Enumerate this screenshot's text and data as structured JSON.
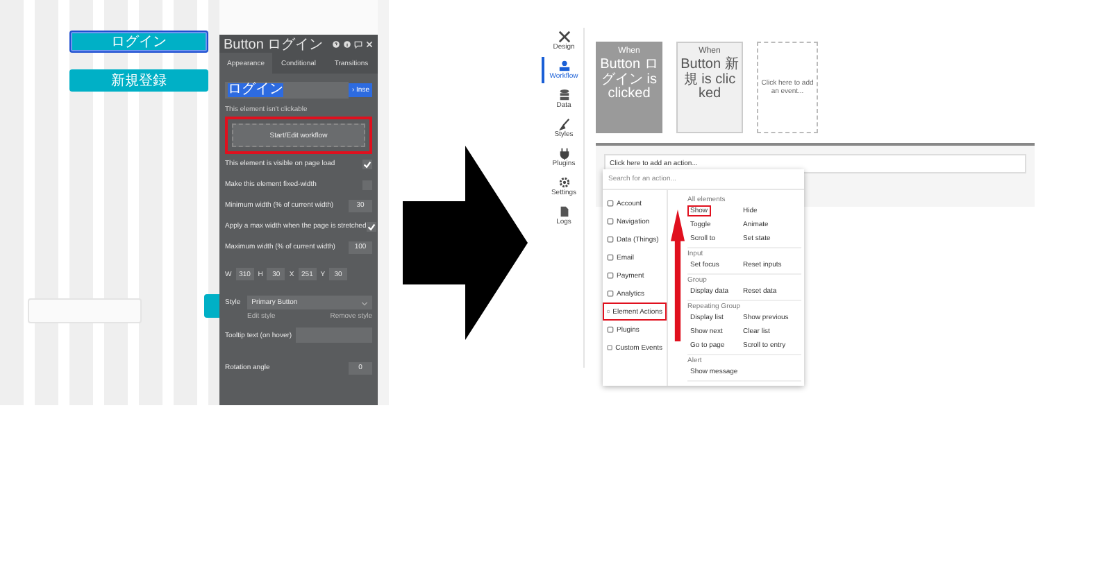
{
  "editor_left": {
    "canvas_buttons": [
      {
        "label": "ログイン",
        "selected": true
      },
      {
        "label": "新規登録",
        "selected": false
      }
    ],
    "panel": {
      "title": "Button ログイン",
      "tabs": [
        {
          "label": "Appearance",
          "selected": true
        },
        {
          "label": "Conditional",
          "selected": false
        },
        {
          "label": "Transitions",
          "selected": false
        }
      ],
      "text_value": "ログイン",
      "dynamic_tag": "› Inse",
      "clickable_note": "This element isn't clickable",
      "workflow_button": {
        "label": "Start/Edit workflow",
        "highlighted": true
      },
      "options": [
        {
          "kind": "check",
          "label": "This element is visible on page load",
          "checked": true
        },
        {
          "kind": "check",
          "label": "Make this element fixed-width",
          "checked": false
        },
        {
          "kind": "number",
          "label": "Minimum width (% of current width)",
          "value": "30"
        },
        {
          "kind": "check",
          "label": "Apply a max width when the page is stretched",
          "checked": true
        },
        {
          "kind": "number",
          "label": "Maximum width (% of current width)",
          "value": "100"
        }
      ],
      "geometry": [
        {
          "label": "W",
          "value": "310"
        },
        {
          "label": "H",
          "value": "30"
        },
        {
          "label": "X",
          "value": "251"
        },
        {
          "label": "Y",
          "value": "30"
        }
      ],
      "style": {
        "label": "Style",
        "value": "Primary Button",
        "edit": "Edit style",
        "remove": "Remove style"
      },
      "tooltip_label": "Tooltip text (on hover)",
      "rotation": {
        "label": "Rotation angle",
        "value": "0"
      }
    }
  },
  "editor_right": {
    "sidebar": [
      {
        "label": "Design",
        "selected": false
      },
      {
        "label": "Workflow",
        "selected": true
      },
      {
        "label": "Data",
        "selected": false
      },
      {
        "label": "Styles",
        "selected": false
      },
      {
        "label": "Plugins",
        "selected": false
      },
      {
        "label": "Settings",
        "selected": false
      },
      {
        "label": "Logs",
        "selected": false
      }
    ],
    "events": [
      {
        "kind": "event",
        "title": "When",
        "text": "Button ログイン is clicked",
        "selected": true
      },
      {
        "kind": "event",
        "title": "When",
        "text": "Button 新規 is clicked",
        "selected": false
      },
      {
        "kind": "add",
        "text": "Click here to add an event..."
      }
    ],
    "action_placeholder": "Click here to add an action...",
    "menu": {
      "search_placeholder": "Search for an action...",
      "categories": [
        {
          "label": "Account",
          "highlighted": false
        },
        {
          "label": "Navigation",
          "highlighted": false
        },
        {
          "label": "Data (Things)",
          "highlighted": false
        },
        {
          "label": "Email",
          "highlighted": false
        },
        {
          "label": "Payment",
          "highlighted": false
        },
        {
          "label": "Analytics",
          "highlighted": false
        },
        {
          "label": "Element Actions",
          "highlighted": true
        },
        {
          "label": "Plugins",
          "highlighted": false
        },
        {
          "label": "Custom Events",
          "highlighted": false
        }
      ],
      "sections": [
        {
          "title": "All elements",
          "items": [
            {
              "label": "Show",
              "highlighted": true
            },
            {
              "label": "Hide",
              "highlighted": false
            },
            {
              "label": "Toggle",
              "highlighted": false
            },
            {
              "label": "Animate",
              "highlighted": false
            },
            {
              "label": "Scroll to",
              "highlighted": false
            },
            {
              "label": "Set state",
              "highlighted": false
            }
          ]
        },
        {
          "title": "Input",
          "items": [
            {
              "label": "Set focus",
              "highlighted": false
            },
            {
              "label": "Reset inputs",
              "highlighted": false
            }
          ]
        },
        {
          "title": "Group",
          "items": [
            {
              "label": "Display data",
              "highlighted": false
            },
            {
              "label": "Reset data",
              "highlighted": false
            }
          ]
        },
        {
          "title": "Repeating Group",
          "items": [
            {
              "label": "Display list",
              "highlighted": false
            },
            {
              "label": "Show previous",
              "highlighted": false
            },
            {
              "label": "Show next",
              "highlighted": false
            },
            {
              "label": "Clear list",
              "highlighted": false
            },
            {
              "label": "Go to page",
              "highlighted": false
            },
            {
              "label": "Scroll to entry",
              "highlighted": false
            }
          ]
        },
        {
          "title": "Alert",
          "items": [
            {
              "label": "Show message",
              "highlighted": false
            }
          ]
        }
      ]
    }
  }
}
